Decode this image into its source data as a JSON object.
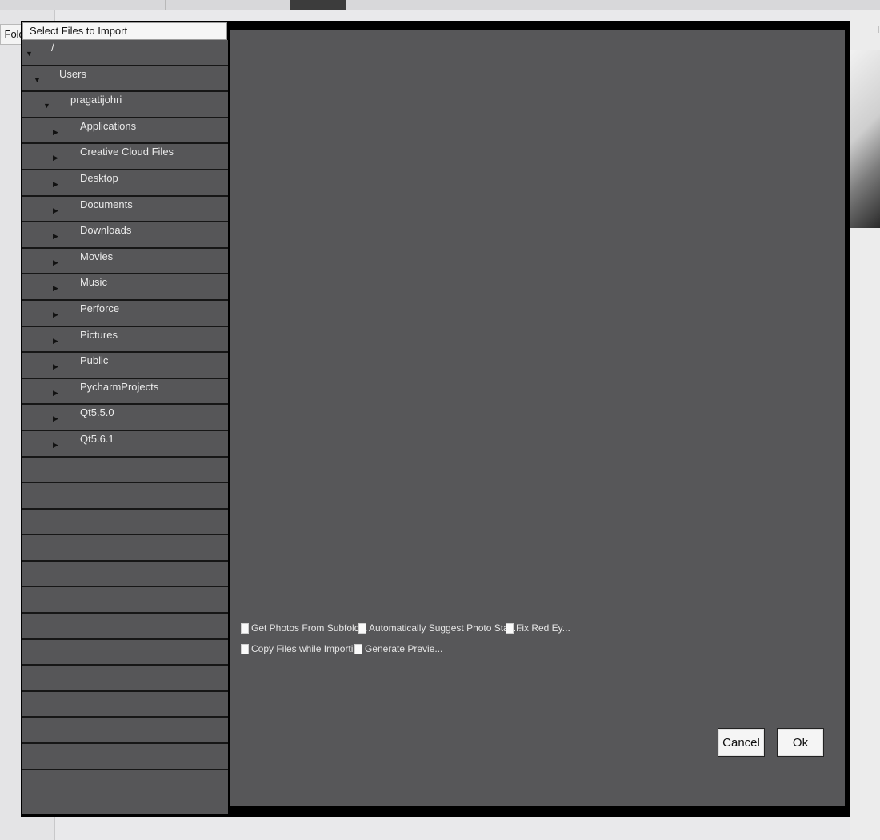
{
  "background": {
    "left_tab_label": "j Fold",
    "right_glyph": "I"
  },
  "dialog": {
    "title": "Select Files to Import",
    "tree": [
      {
        "label": "/",
        "arrow": "▼",
        "depth": 0
      },
      {
        "label": "Users",
        "arrow": "▼",
        "depth": 1
      },
      {
        "label": "pragatijohri",
        "arrow": "▼",
        "depth": 2
      },
      {
        "label": "Applications",
        "arrow": "▶",
        "depth": 3
      },
      {
        "label": "Creative Cloud Files",
        "arrow": "▶",
        "depth": 3
      },
      {
        "label": "Desktop",
        "arrow": "▶",
        "depth": 3
      },
      {
        "label": "Documents",
        "arrow": "▶",
        "depth": 3
      },
      {
        "label": "Downloads",
        "arrow": "▶",
        "depth": 3
      },
      {
        "label": "Movies",
        "arrow": "▶",
        "depth": 3
      },
      {
        "label": "Music",
        "arrow": "▶",
        "depth": 3
      },
      {
        "label": "Perforce",
        "arrow": "▶",
        "depth": 3
      },
      {
        "label": "Pictures",
        "arrow": "▶",
        "depth": 3
      },
      {
        "label": "Public",
        "arrow": "▶",
        "depth": 3
      },
      {
        "label": "PycharmProjects",
        "arrow": "▶",
        "depth": 3
      },
      {
        "label": "Qt5.5.0",
        "arrow": "▶",
        "depth": 3
      },
      {
        "label": "Qt5.6.1",
        "arrow": "▶",
        "depth": 3
      },
      {
        "label": "",
        "arrow": "",
        "depth": 0
      },
      {
        "label": "",
        "arrow": "",
        "depth": 0
      },
      {
        "label": "",
        "arrow": "",
        "depth": 0
      },
      {
        "label": "",
        "arrow": "",
        "depth": 0
      },
      {
        "label": "",
        "arrow": "",
        "depth": 0
      },
      {
        "label": "",
        "arrow": "",
        "depth": 0
      },
      {
        "label": "",
        "arrow": "",
        "depth": 0
      },
      {
        "label": "",
        "arrow": "",
        "depth": 0
      },
      {
        "label": "",
        "arrow": "",
        "depth": 0
      },
      {
        "label": "",
        "arrow": "",
        "depth": 0
      },
      {
        "label": "",
        "arrow": "",
        "depth": 0
      },
      {
        "label": "",
        "arrow": "",
        "depth": 0
      }
    ],
    "options": {
      "get_photos_from_subfolders": {
        "label": "Get Photos From Subfold...",
        "checked": false
      },
      "auto_suggest_photo_stacks": {
        "label": "Automatically Suggest Photo Stac...",
        "checked": false
      },
      "fix_red_eyes": {
        "label": "Fix Red Ey...",
        "checked": false
      },
      "copy_files_while_importing": {
        "label": "Copy Files while Importi...",
        "checked": false
      },
      "generate_previews": {
        "label": "Generate Previe...",
        "checked": false
      }
    },
    "buttons": {
      "cancel": "Cancel",
      "ok": "Ok"
    }
  },
  "colors": {
    "panel": "#575759",
    "tree_row": "#565658",
    "row_divider": "#161616",
    "frame": "#000000"
  }
}
